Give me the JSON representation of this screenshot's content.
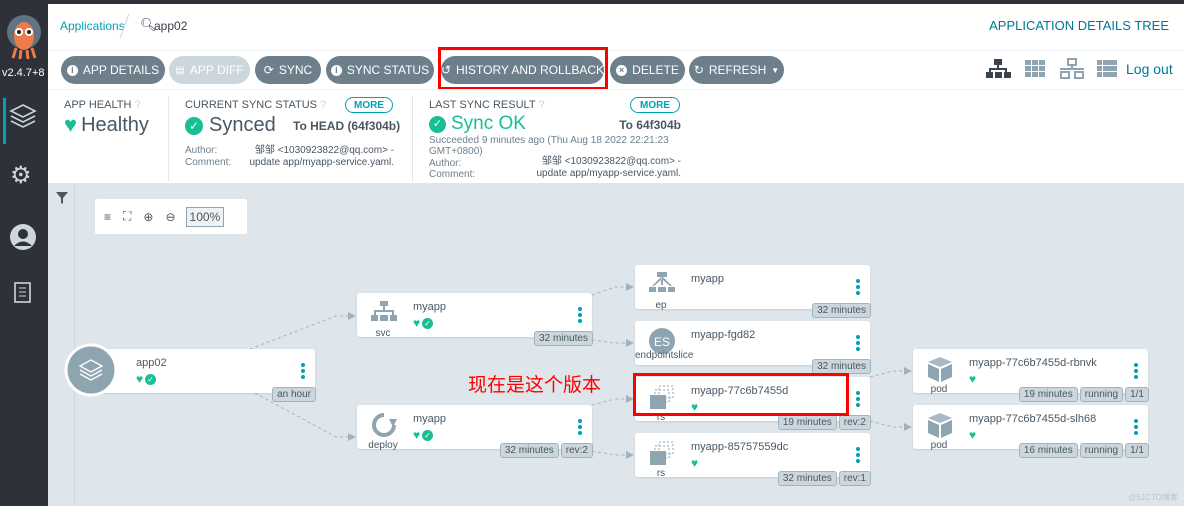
{
  "sidebar": {
    "version": "v2.4.7+8",
    "items": [
      "applications",
      "settings",
      "user-info",
      "docs"
    ]
  },
  "header": {
    "breadcrumb_root": "Applications",
    "app_name": "app02",
    "view_title": "APPLICATION DETAILS TREE",
    "logout": "Log out"
  },
  "toolbar": {
    "buttons": [
      "APP DETAILS",
      "APP DIFF",
      "SYNC",
      "SYNC STATUS",
      "HISTORY AND ROLLBACK",
      "DELETE",
      "REFRESH"
    ]
  },
  "status": {
    "health": {
      "label": "APP HEALTH",
      "value": "Healthy"
    },
    "current_sync": {
      "label": "CURRENT SYNC STATUS",
      "more": "MORE",
      "value": "Synced",
      "target": "To HEAD (64f304b)",
      "author_label": "Author:",
      "author": "邹邹 <1030923822@qq.com> -",
      "comment_label": "Comment:",
      "comment": "update app/myapp-service.yaml."
    },
    "last_sync": {
      "label": "LAST SYNC RESULT",
      "more": "MORE",
      "value": "Sync OK",
      "target": "To 64f304b",
      "time": "Succeeded 9 minutes ago (Thu Aug 18 2022 22:21:23 GMT+0800)",
      "author_label": "Author:",
      "author": "邹邹 <1030923822@qq.com> -",
      "comment_label": "Comment:",
      "comment": "update app/myapp-service.yaml."
    }
  },
  "zoom": {
    "level": "100%"
  },
  "annotation": "现在是这个版本",
  "colors": {
    "healthy": "#18be94",
    "button": "#6d7f8b",
    "accent": "#00a2b3",
    "highlight": "#ff0000"
  },
  "nodes": {
    "app": {
      "name": "app02",
      "tags": [
        "an hour"
      ]
    },
    "svc": {
      "name": "myapp",
      "kind": "svc",
      "tags": [
        "32 minutes"
      ]
    },
    "deploy": {
      "name": "myapp",
      "kind": "deploy",
      "tags": [
        "32 minutes",
        "rev:2"
      ]
    },
    "ep": {
      "name": "myapp",
      "kind": "ep",
      "tags": [
        "32 minutes"
      ]
    },
    "es": {
      "name": "myapp-fgd82",
      "kind": "endpointslice",
      "tags": [
        "32 minutes"
      ],
      "icon_text": "ES"
    },
    "rs1": {
      "name": "myapp-77c6b7455d",
      "kind": "rs",
      "tags": [
        "19 minutes",
        "rev:2"
      ]
    },
    "rs2": {
      "name": "myapp-85757559dc",
      "kind": "rs",
      "tags": [
        "32 minutes",
        "rev:1"
      ]
    },
    "pod1": {
      "name": "myapp-77c6b7455d-rbnvk",
      "kind": "pod",
      "tags": [
        "19 minutes",
        "running",
        "1/1"
      ]
    },
    "pod2": {
      "name": "myapp-77c6b7455d-slh68",
      "kind": "pod",
      "tags": [
        "16 minutes",
        "running",
        "1/1"
      ]
    }
  },
  "watermark": "@51CTO博客"
}
